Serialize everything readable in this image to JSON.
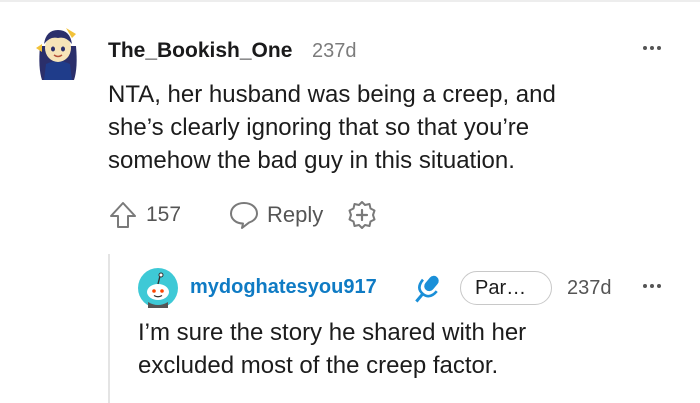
{
  "comment": {
    "author": "The_Bookish_One",
    "age": "237d",
    "body_lines": [
      "NTA, her husband was being a creep, and",
      "she’s clearly ignoring that so that you’re",
      "somehow the bad guy in this situation."
    ],
    "votes": "157",
    "reply_label": "Reply",
    "avatar_icon": "anime-avatar-icon",
    "upvote_icon": "upvote-arrow-icon",
    "reply_icon": "speech-bubble-icon",
    "award_icon": "award-plus-icon",
    "more_icon": "more-options-icon"
  },
  "reply": {
    "author": "mydoghatesyou917",
    "flair": "Par…",
    "age": "237d",
    "body_lines": [
      "I’m sure the story he shared with her",
      "excluded most of the creep factor."
    ],
    "avatar_icon": "snoo-avatar-icon",
    "mic_icon": "microphone-icon",
    "more_icon": "more-options-icon",
    "username_color": "#0f7bc4",
    "mic_color": "#1a8fd8"
  }
}
